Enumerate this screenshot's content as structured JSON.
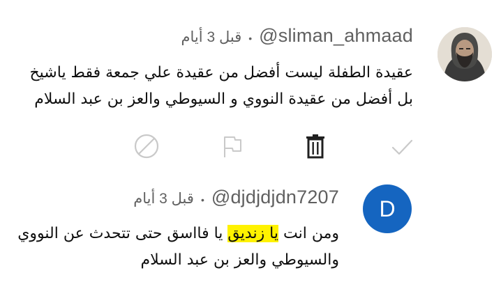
{
  "comments": [
    {
      "username": "@sliman_ahmaad",
      "separator": "•",
      "time": "قبل 3 أيام",
      "lines": [
        "عقيدة الطفلة ليست أفضل من عقيدة علي جمعة فقط ياشيخ",
        "بل أفضل من عقيدة النووي و السيوطي والعز بن عبد السلام"
      ],
      "actions": [
        "check-icon",
        "delete-icon",
        "flag-icon",
        "block-icon"
      ]
    },
    {
      "username": "@djdjdjdn7207",
      "separator": "•",
      "time": "قبل 3 أيام",
      "avatar_letter": "D",
      "avatar_color": "#1565c0",
      "line1_before": "ومن انت ",
      "line1_highlight": "يا زنديق",
      "line1_after": " يا فااسق حتى تتحدث عن النووي",
      "line2": "والسيوطي والعز بن عبد السلام",
      "highlight_color": "#fff200"
    }
  ]
}
